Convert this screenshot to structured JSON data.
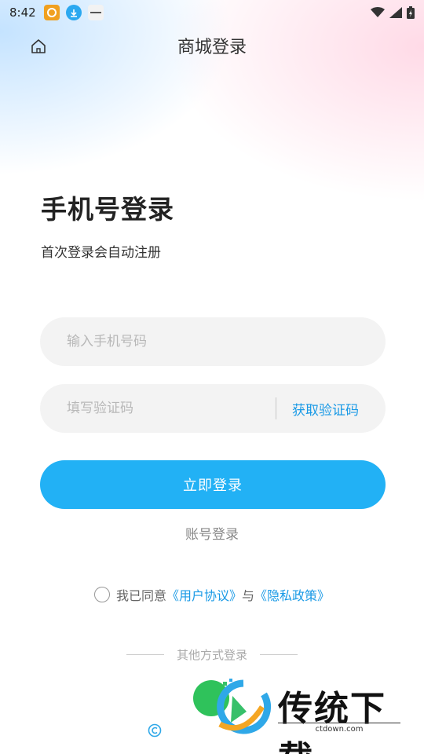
{
  "status_bar": {
    "time": "8:42",
    "app_icons": [
      "app-notification-icon-1",
      "download-icon",
      "app-notification-icon-3"
    ]
  },
  "nav": {
    "title": "商城登录",
    "home_icon": "home-icon"
  },
  "page": {
    "heading": "手机号登录",
    "subheading": "首次登录会自动注册"
  },
  "form": {
    "phone_placeholder": "输入手机号码",
    "phone_value": "",
    "code_placeholder": "填写验证码",
    "code_value": "",
    "get_code_label": "获取验证码",
    "login_label": "立即登录",
    "account_login_label": "账号登录"
  },
  "agreement": {
    "prefix": "我已同意",
    "terms_link": "《用户协议》",
    "connector": "与",
    "privacy_link": "《隐私政策》",
    "checked": false
  },
  "other_login": {
    "label": "其他方式登录"
  },
  "watermark": {
    "text": "传统下载",
    "sub": "ctdown.com"
  },
  "colors": {
    "primary": "#22b1f5",
    "link": "#1a9ae6",
    "wechat": "#2fc25b"
  }
}
